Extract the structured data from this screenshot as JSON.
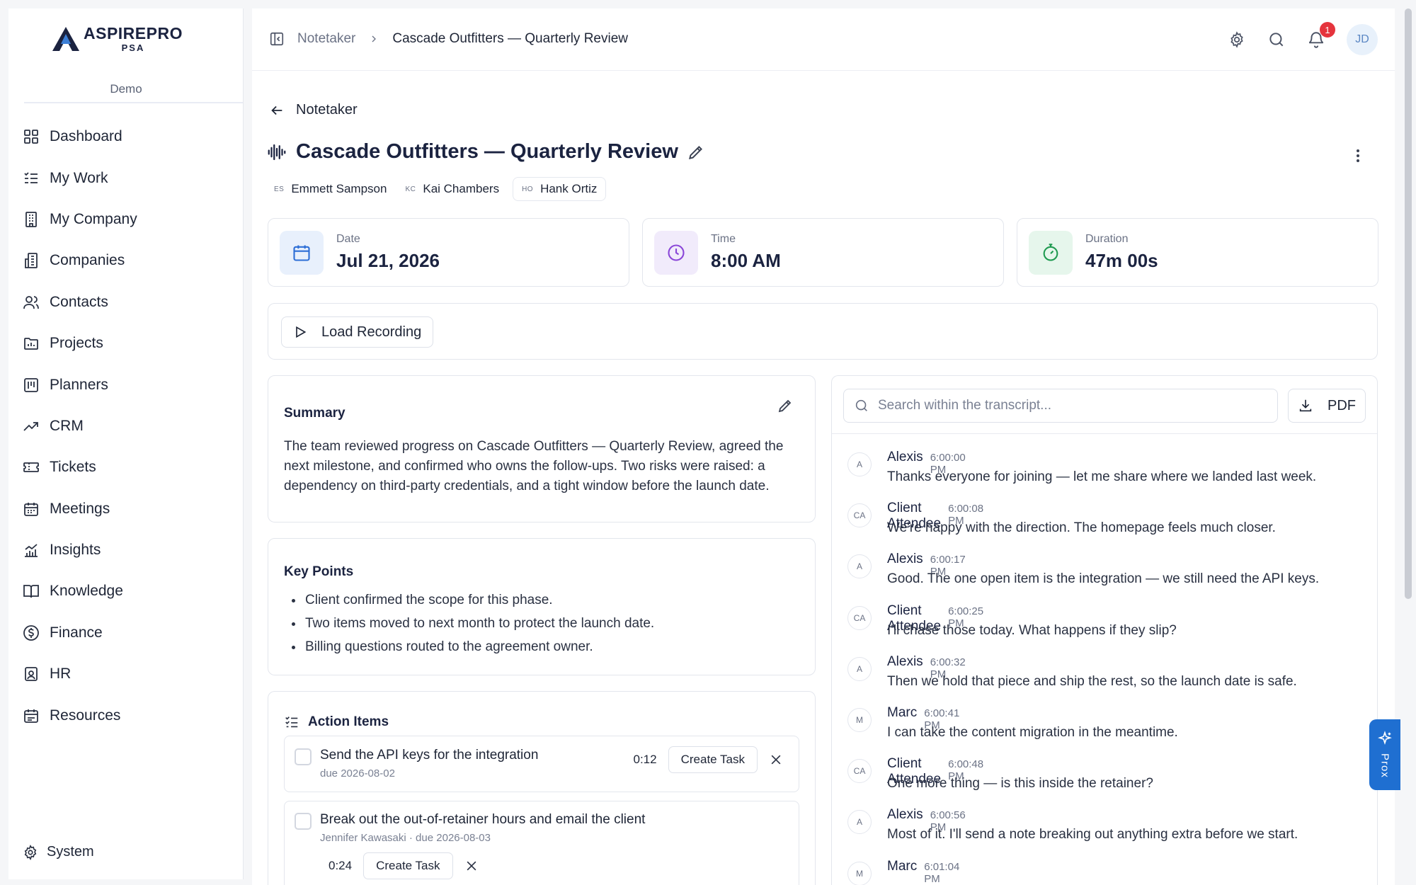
{
  "brand": {
    "name": "ASPIREPRO",
    "sub": "PSA",
    "environment": "Demo"
  },
  "sidebar": {
    "items": [
      {
        "label": "Dashboard",
        "icon": "dashboard-icon"
      },
      {
        "label": "My Work",
        "icon": "my-work-icon"
      },
      {
        "label": "My Company",
        "icon": "building-icon"
      },
      {
        "label": "Companies",
        "icon": "companies-icon"
      },
      {
        "label": "Contacts",
        "icon": "contacts-icon"
      },
      {
        "label": "Projects",
        "icon": "projects-icon"
      },
      {
        "label": "Planners",
        "icon": "planners-icon"
      },
      {
        "label": "CRM",
        "icon": "trend-icon"
      },
      {
        "label": "Tickets",
        "icon": "ticket-icon"
      },
      {
        "label": "Meetings",
        "icon": "calendar-icon"
      },
      {
        "label": "Insights",
        "icon": "chart-icon"
      },
      {
        "label": "Knowledge",
        "icon": "book-icon"
      },
      {
        "label": "Finance",
        "icon": "dollar-icon"
      },
      {
        "label": "HR",
        "icon": "badge-icon"
      },
      {
        "label": "Resources",
        "icon": "resources-icon"
      }
    ],
    "system_label": "System"
  },
  "header": {
    "breadcrumb": [
      "Notetaker",
      "Cascade Outfitters — Quarterly Review"
    ],
    "notification_count": "1",
    "user_initials": "JD"
  },
  "page": {
    "back_label": "Notetaker",
    "title": "Cascade Outfitters — Quarterly Review",
    "attendees": [
      {
        "initials": "ES",
        "name": "Emmett Sampson"
      },
      {
        "initials": "KC",
        "name": "Kai Chambers"
      },
      {
        "initials": "HO",
        "name": "Hank Ortiz"
      }
    ],
    "stats": [
      {
        "label": "Date",
        "value": "Jul 21, 2026"
      },
      {
        "label": "Time",
        "value": "8:00 AM"
      },
      {
        "label": "Duration",
        "value": "47m 00s"
      }
    ],
    "load_recording_label": "Load Recording"
  },
  "summary": {
    "title": "Summary",
    "text": "The team reviewed progress on Cascade Outfitters — Quarterly Review, agreed the next milestone, and confirmed who owns the follow-ups. Two risks were raised: a dependency on third-party credentials, and a tight window before the launch date."
  },
  "key_points": {
    "title": "Key Points",
    "items": [
      "Client confirmed the scope for this phase.",
      "Two items moved to next month to protect the launch date.",
      "Billing questions routed to the agreement owner."
    ]
  },
  "action_items": {
    "title": "Action Items",
    "create_label": "Create Task",
    "items": [
      {
        "title": "Send the API keys for the integration",
        "meta": "due 2026-08-02",
        "time": "0:12"
      },
      {
        "title": "Break out the out-of-retainer hours and email the client",
        "meta": "Jennifer Kawasaki · due 2026-08-03",
        "time": "0:24"
      }
    ]
  },
  "transcript": {
    "search_placeholder": "Search within the transcript...",
    "pdf_label": "PDF",
    "messages": [
      {
        "initials": "A",
        "speaker": "Alexis",
        "time": "6:00:00 PM",
        "text": "Thanks everyone for joining — let me share where we landed last week."
      },
      {
        "initials": "CA",
        "speaker": "Client Attendee",
        "time": "6:00:08 PM",
        "text": "We're happy with the direction. The homepage feels much closer."
      },
      {
        "initials": "A",
        "speaker": "Alexis",
        "time": "6:00:17 PM",
        "text": "Good. The one open item is the integration — we still need the API keys."
      },
      {
        "initials": "CA",
        "speaker": "Client Attendee",
        "time": "6:00:25 PM",
        "text": "I'll chase those today. What happens if they slip?"
      },
      {
        "initials": "A",
        "speaker": "Alexis",
        "time": "6:00:32 PM",
        "text": "Then we hold that piece and ship the rest, so the launch date is safe."
      },
      {
        "initials": "M",
        "speaker": "Marc",
        "time": "6:00:41 PM",
        "text": "I can take the content migration in the meantime."
      },
      {
        "initials": "CA",
        "speaker": "Client Attendee",
        "time": "6:00:48 PM",
        "text": "One more thing — is this inside the retainer?"
      },
      {
        "initials": "A",
        "speaker": "Alexis",
        "time": "6:00:56 PM",
        "text": "Most of it. I'll send a note breaking out anything extra before we start."
      },
      {
        "initials": "M",
        "speaker": "Marc",
        "time": "6:01:04 PM",
        "text": ""
      }
    ]
  },
  "assistant": {
    "label": "Prox"
  },
  "colors": {
    "accent": "#1f6fd1",
    "brand_navy": "#1b2340",
    "danger": "#e5343d",
    "date_tint": "#e8f0fc",
    "time_tint": "#f1ebfb",
    "duration_tint": "#e6f6ec"
  }
}
